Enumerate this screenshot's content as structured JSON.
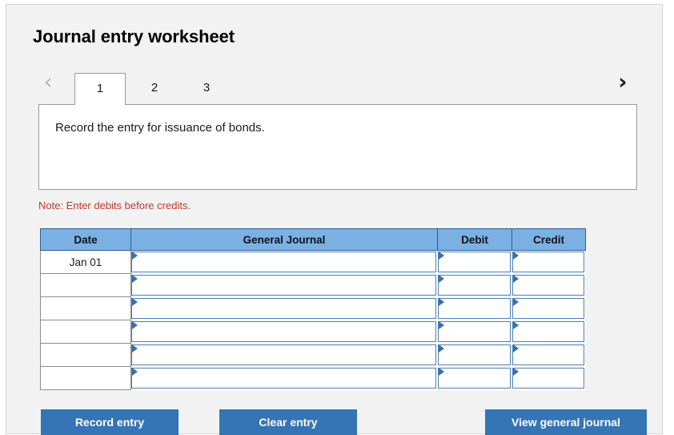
{
  "panel": {
    "title": "Journal entry worksheet"
  },
  "tabs": {
    "prev_arrow": "‹",
    "next_arrow": "›",
    "items": [
      {
        "label": "1",
        "active": true
      },
      {
        "label": "2",
        "active": false
      },
      {
        "label": "3",
        "active": false
      }
    ]
  },
  "prompt": {
    "text": "Record the entry for issuance of bonds."
  },
  "note": {
    "text": "Note: Enter debits before credits."
  },
  "table": {
    "headers": [
      "Date",
      "General Journal",
      "Debit",
      "Credit"
    ],
    "rows": [
      {
        "date": "Jan 01",
        "general_journal": "",
        "debit": "",
        "credit": ""
      },
      {
        "date": "",
        "general_journal": "",
        "debit": "",
        "credit": ""
      },
      {
        "date": "",
        "general_journal": "",
        "debit": "",
        "credit": ""
      },
      {
        "date": "",
        "general_journal": "",
        "debit": "",
        "credit": ""
      },
      {
        "date": "",
        "general_journal": "",
        "debit": "",
        "credit": ""
      },
      {
        "date": "",
        "general_journal": "",
        "debit": "",
        "credit": ""
      }
    ]
  },
  "buttons": {
    "record_entry": "Record entry",
    "clear_entry": "Clear entry",
    "view_general_journal": "View general journal"
  },
  "colors": {
    "header_blue": "#7bb0e5",
    "button_blue": "#3574b5",
    "note_red": "#c0392b",
    "panel_background": "#f2f2f2",
    "cell_border_blue": "#4a7fb5"
  }
}
